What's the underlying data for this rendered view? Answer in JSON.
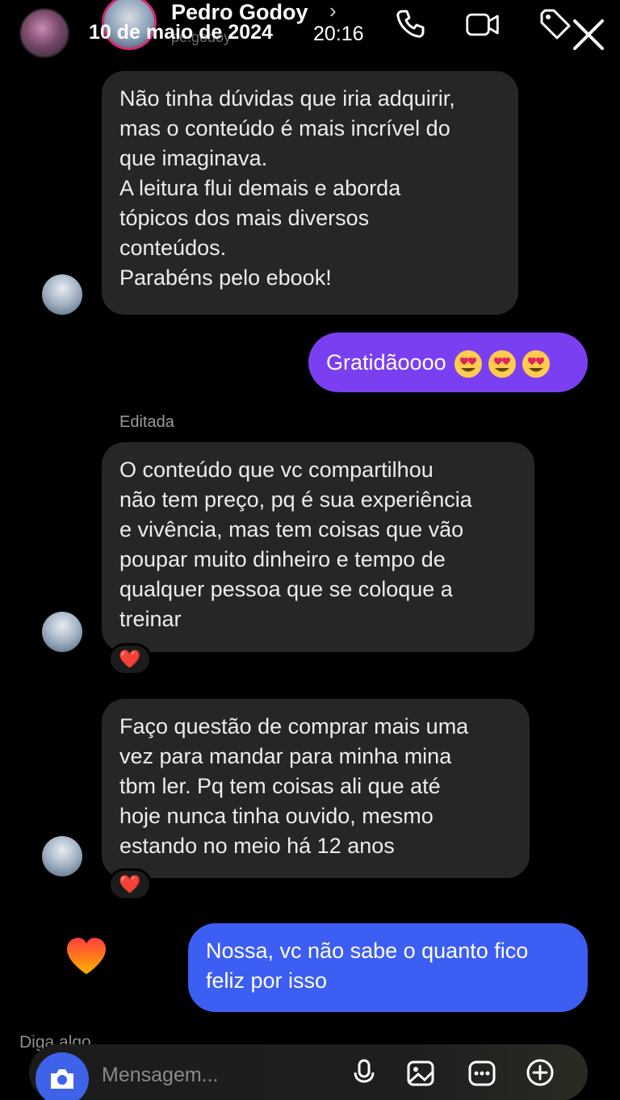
{
  "header": {
    "contact_name": "Pedro Godoy",
    "contact_handle": "pe.godoy",
    "story_date": "10 de maio de 2024",
    "story_time": "20:16"
  },
  "messages": [
    {
      "from": "them",
      "text": "Não tinha dúvidas que iria adquirir,\nmas o conteúdo é mais incrível do\nque imaginava.\nA leitura flui demais e aborda\ntópicos dos mais diversos\nconteúdos.\nParabéns pelo ebook!"
    },
    {
      "from": "me",
      "text": "Gratidãoooo",
      "emoji": "heart-eyes",
      "emoji_count": 3
    },
    {
      "from": "them",
      "label": "Editada",
      "text": "O conteúdo que vc compartilhou\nnão tem preço, pq é sua experiência\ne vivência, mas tem coisas que vão\npoupar muito dinheiro e tempo de\nqualquer pessoa que se coloque a\ntreinar",
      "reaction": "❤️"
    },
    {
      "from": "them",
      "text": "Faço questão de comprar mais uma\nvez para mandar para minha mina\ntbm ler. Pq tem coisas ali que até\nhoje nunca tinha ouvido, mesmo\nestando no meio há 12 anos",
      "reaction": "❤️"
    },
    {
      "from": "me",
      "text": "Nossa, vc não sabe o quanto fico\nfeliz por isso"
    }
  ],
  "composer": {
    "hint": "Diga algo...",
    "placeholder": "Mensagem..."
  },
  "colors": {
    "incoming_bubble": "#262626",
    "outgoing_purple": "#7b3ff2",
    "outgoing_blue": "#3d5ef3",
    "camera_button": "#3e63e8"
  }
}
